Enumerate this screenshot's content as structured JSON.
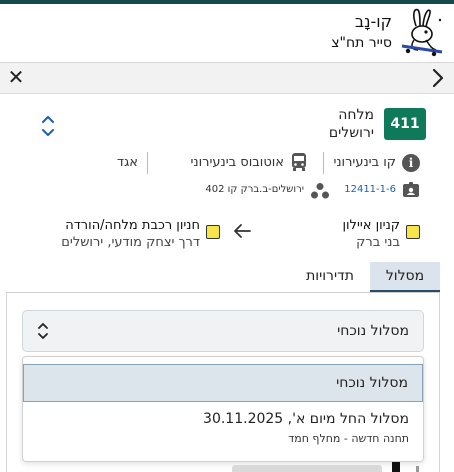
{
  "brand": {
    "title": "קו-נָב",
    "subtitle": "סייר תח\"צ",
    "logo_icon": "rabbit-skater-icon"
  },
  "nav": {
    "close_icon": "close-icon",
    "close_glyph": "✕",
    "back_icon": "chevron-right-icon"
  },
  "line": {
    "number": "411",
    "badge_color": "#0f7a5a",
    "route_line1": "מלחה",
    "route_line2": "ירושלים"
  },
  "info": {
    "info_glyph": "i",
    "operator": "קו בינעירוני",
    "agency": "אוטובוס בינעירוני",
    "cluster": "אגד",
    "line_id": "12411-1-6",
    "route_desc": "ירושלים-ב.ברק קו 402"
  },
  "stops": {
    "origin_name": "קניון איילון",
    "origin_city": "בני ברק",
    "destination_name": "חניון רכבת מלחה/הורדה",
    "destination_city": "דרך יצחק מודעי, ירושלים",
    "stop_color": "#f6e44a"
  },
  "tabs": {
    "route": "מסלול",
    "frequency": "תדירויות",
    "active": "route"
  },
  "select": {
    "value": "מסלול נוכחי",
    "options": [
      {
        "label": "מסלול נוכחי",
        "selected": true
      },
      {
        "label": "מסלול החל מיום א', 30.11.2025",
        "sub": "תחנה חדשה - מחלף חמד",
        "selected": false
      }
    ]
  }
}
